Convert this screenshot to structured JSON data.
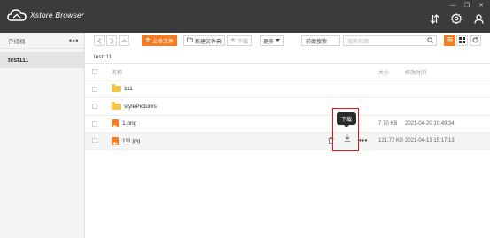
{
  "app": {
    "title": "Xstore Browser"
  },
  "window_controls": [
    "—",
    "❐",
    "✕"
  ],
  "sidebar": {
    "header": "存储桶",
    "more": "•••",
    "items": [
      {
        "label": "test111",
        "selected": true
      }
    ]
  },
  "toolbar": {
    "upload_label": "上传文件",
    "new_folder_label": "新建文件夹",
    "download_label": "下载",
    "more_label": "更多",
    "search_type": "前缀搜索",
    "search_placeholder": "搜索前缀"
  },
  "path": "test111",
  "table": {
    "columns": {
      "name": "名称",
      "size": "大小",
      "modified": "修改时间"
    },
    "rows": [
      {
        "type": "folder",
        "name": "111",
        "size": "",
        "modified": ""
      },
      {
        "type": "folder",
        "name": "stylePictures",
        "size": "",
        "modified": ""
      },
      {
        "type": "image",
        "name": "1.png",
        "size": "7.70 KB",
        "modified": "2021-04-20 10:49:34"
      },
      {
        "type": "image",
        "name": "111.jpg",
        "size": "121.72 KB",
        "modified": "2021-04-13 15:17:13"
      }
    ]
  },
  "row_actions": {
    "more": "•••"
  },
  "tooltip": "下载",
  "colors": {
    "accent": "#f57c20",
    "titlebar": "#3b3b3b",
    "highlight": "#ee1111"
  },
  "icons": [
    "cloud-logo-icon",
    "transfer-icon",
    "gear-icon",
    "user-icon",
    "upload-icon",
    "new-folder-icon",
    "download-icon",
    "search-icon",
    "list-view-icon",
    "grid-view-icon",
    "refresh-icon",
    "folder-icon",
    "image-file-icon",
    "trash-icon"
  ]
}
